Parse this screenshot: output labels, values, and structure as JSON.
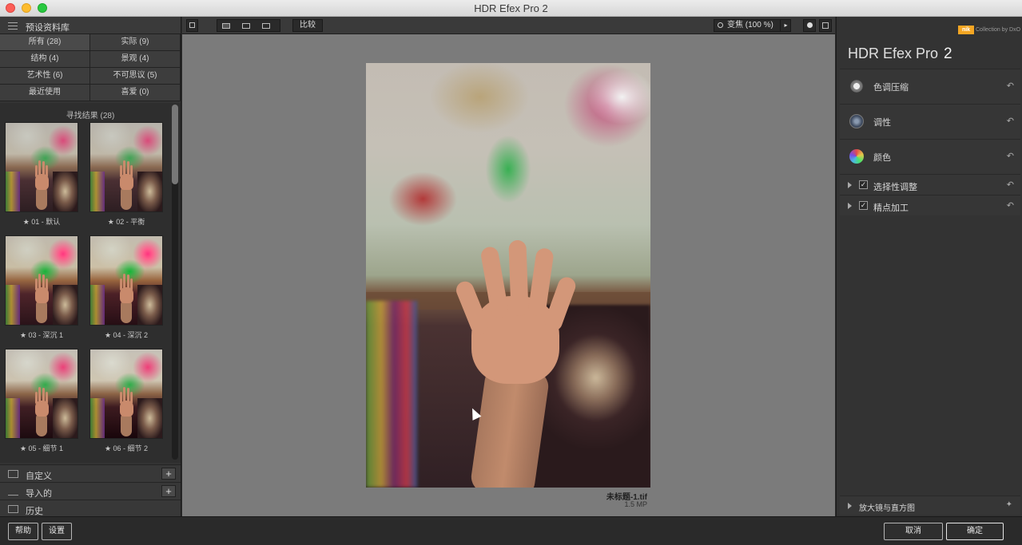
{
  "window": {
    "title": "HDR Efex Pro 2"
  },
  "library": {
    "header": "预设资料库",
    "filters": [
      {
        "label": "所有 (28)"
      },
      {
        "label": "实际 (9)"
      },
      {
        "label": "结构 (4)"
      },
      {
        "label": "景观 (4)"
      },
      {
        "label": "艺术性 (6)"
      },
      {
        "label": "不可思议 (5)"
      },
      {
        "label": "最近使用"
      },
      {
        "label": "喜爱 (0)"
      }
    ],
    "results_title": "寻找结果 (28)",
    "presets": [
      {
        "label": "★ 01 - 默认"
      },
      {
        "label": "★ 02 - 平衡"
      },
      {
        "label": "★ 03 - 深沉 1"
      },
      {
        "label": "★ 04 - 深沉 2"
      },
      {
        "label": "★ 05 - 细节 1"
      },
      {
        "label": "★ 06 - 细节 2"
      }
    ],
    "sections": [
      {
        "label": "自定义",
        "has_add": true
      },
      {
        "label": "导入的",
        "has_add": true
      },
      {
        "label": "历史",
        "has_add": false
      }
    ]
  },
  "toolbar": {
    "compare_label": "比较",
    "zoom_label": "变焦 (100 %)",
    "zoom_icon": "magnifier-icon"
  },
  "image": {
    "filename": "未标题-1.tif",
    "size": "1.5 MP"
  },
  "right_panel": {
    "brand_logo": "nik",
    "brand_sub": "Collection by DxO",
    "brand_name": "HDR Efex Pro",
    "brand_version": "2",
    "sections": [
      {
        "label": "色调压缩",
        "icon": "sun-icon"
      },
      {
        "label": "调性",
        "icon": "aperture-icon"
      },
      {
        "label": "颜色",
        "icon": "color-wheel-icon"
      }
    ],
    "toggles": [
      {
        "label": "选择性调整",
        "checked": "✓"
      },
      {
        "label": "精点加工",
        "checked": "✓"
      }
    ],
    "loupe_label": "放大镜与直方图"
  },
  "bottom": {
    "help": "帮助",
    "settings": "设置",
    "cancel": "取消",
    "ok": "确定"
  }
}
